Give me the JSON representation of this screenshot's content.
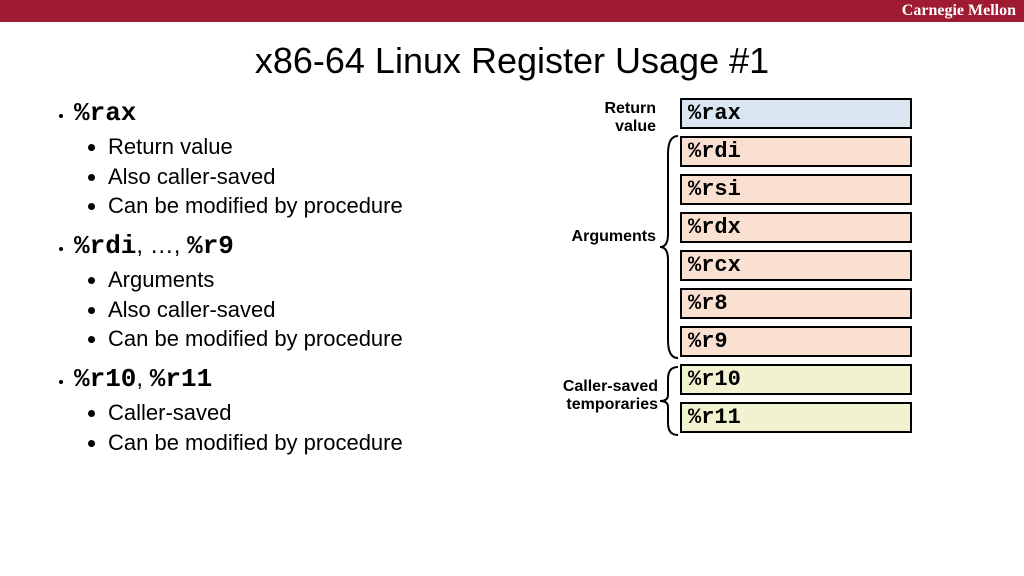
{
  "brand": "Carnegie Mellon",
  "title": "x86-64 Linux Register Usage #1",
  "left": {
    "g0": {
      "head_a": "%rax",
      "b0": "Return value",
      "b1": "Also caller-saved",
      "b2": "Can be modified by procedure"
    },
    "g1": {
      "head_a": "%rdi",
      "head_mid": ", …, ",
      "head_b": "%r9",
      "b0": "Arguments",
      "b1": "Also caller-saved",
      "b2": "Can be modified by procedure"
    },
    "g2": {
      "head_a": "%r10",
      "head_mid": ", ",
      "head_b": "%r11",
      "b0": "Caller-saved",
      "b1": "Can be modified by procedure"
    }
  },
  "right": {
    "lab0a": "Return",
    "lab0b": "value",
    "lab1": "Arguments",
    "lab2a": "Caller-saved",
    "lab2b": "temporaries",
    "r0": "%rax",
    "r1": "%rdi",
    "r2": "%rsi",
    "r3": "%rdx",
    "r4": "%rcx",
    "r5": "%r8",
    "r6": "%r9",
    "r7": "%r10",
    "r8": "%r11"
  }
}
